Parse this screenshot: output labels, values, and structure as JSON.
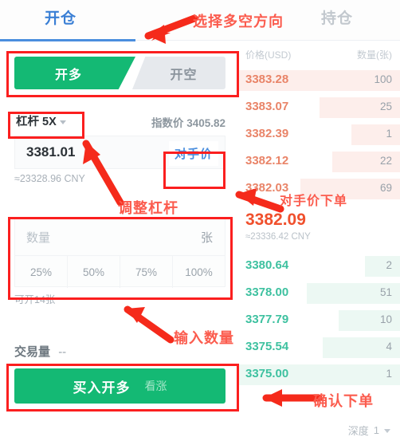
{
  "tabs": {
    "open_position": "开仓",
    "holdings": "持仓"
  },
  "order_form": {
    "direction": {
      "long_label": "开多",
      "short_label": "开空",
      "selected": "开多",
      "long_color": "#14b974",
      "short_color": "#e6e9ed"
    },
    "leverage": {
      "label": "杠杆 5X",
      "value": "5X"
    },
    "index_price": "指数价 3405.82",
    "price_input": {
      "value": "3381.01",
      "opponent_button": "对手价"
    },
    "cny_equivalent": "≈23328.96 CNY",
    "quantity": {
      "placeholder": "数量",
      "unit": "张",
      "percents": [
        "25%",
        "50%",
        "75%",
        "100%"
      ]
    },
    "available": "可开14张",
    "volume": {
      "label": "交易量",
      "value": "--"
    },
    "submit": {
      "main": "买入开多",
      "sub": "看涨"
    }
  },
  "order_book": {
    "header": {
      "price": "价格(USD)",
      "quantity": "数量(张)"
    },
    "asks": [
      {
        "price": "3383.28",
        "qty": "100",
        "depth": 100
      },
      {
        "price": "3383.07",
        "qty": "25",
        "depth": 50
      },
      {
        "price": "3382.39",
        "qty": "1",
        "depth": 30
      },
      {
        "price": "3382.12",
        "qty": "22",
        "depth": 42
      },
      {
        "price": "3382.03",
        "qty": "69",
        "depth": 62
      }
    ],
    "last": {
      "price": "3382.09",
      "cny": "≈23336.42 CNY",
      "color": "#f0502d"
    },
    "bids": [
      {
        "price": "3380.64",
        "qty": "2",
        "depth": 22
      },
      {
        "price": "3378.00",
        "qty": "51",
        "depth": 58
      },
      {
        "price": "3377.79",
        "qty": "10",
        "depth": 38
      },
      {
        "price": "3375.54",
        "qty": "4",
        "depth": 48
      },
      {
        "price": "3375.00",
        "qty": "1",
        "depth": 100
      }
    ],
    "depth_selector": {
      "label": "深度",
      "value": "1"
    }
  },
  "annotations": {
    "direction": "选择多空方向",
    "leverage": "调整杠杆",
    "opponent_price_order": "对手价下单",
    "input_quantity": "输入数量",
    "confirm_order": "确认下单",
    "color": "#fb5c4e",
    "box_color": "#fb1f1f"
  }
}
